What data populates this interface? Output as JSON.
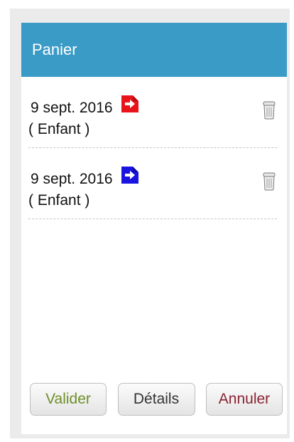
{
  "panel": {
    "title": "Panier"
  },
  "cart": {
    "items": [
      {
        "date": "9 sept. 2016",
        "type": "( Enfant )",
        "flag_icon": "exit-arrow-icon",
        "flag_color": "#e8141a"
      },
      {
        "date": "9 sept. 2016",
        "type": "( Enfant )",
        "flag_icon": "return-arrow-icon",
        "flag_color": "#1a14e0"
      }
    ]
  },
  "buttons": {
    "validate": "Valider",
    "details": "Détails",
    "cancel": "Annuler"
  },
  "colors": {
    "header": "#3a9bc7",
    "validate_text": "#6f8f2b",
    "cancel_text": "#8b2232"
  }
}
